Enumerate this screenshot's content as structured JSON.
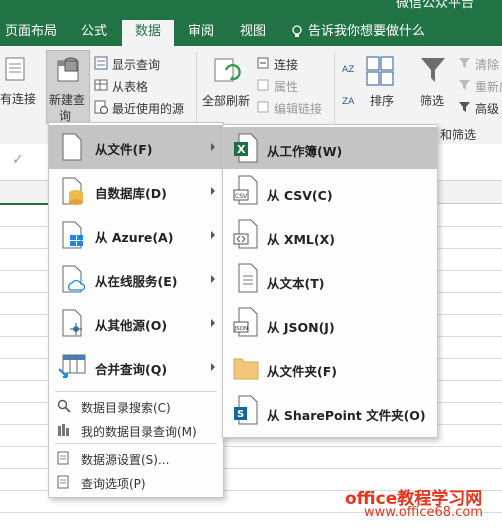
{
  "window": {
    "title_partial": "微信公众平台"
  },
  "tabs": [
    {
      "label": "页面布局"
    },
    {
      "label": "公式"
    },
    {
      "label": "数据"
    },
    {
      "label": "审阅"
    },
    {
      "label": "视图"
    }
  ],
  "tellme": {
    "text": "告诉我你想要做什么"
  },
  "ribbon": {
    "existing_connections": "有连接",
    "new_query_line1": "新建查",
    "new_query_line2": "询",
    "show_queries": "显示查询",
    "from_table": "从表格",
    "recent_sources": "最近使用的源",
    "refresh_all": "全部刷新",
    "connections": "连接",
    "properties": "属性",
    "edit_links": "编辑链接",
    "sort": "排序",
    "filter": "筛选",
    "clear": "清除",
    "reapply": "重新应用",
    "advanced": "高级",
    "filter_group_label": "和筛选"
  },
  "menu1": {
    "items": [
      {
        "label": "从文件(F)"
      },
      {
        "label": "自数据库(D)"
      },
      {
        "label": "从 Azure(A)"
      },
      {
        "label": "从在线服务(E)"
      },
      {
        "label": "从其他源(O)"
      },
      {
        "label": "合并查询(Q)"
      }
    ],
    "extras": [
      {
        "label": "数据目录搜索(C)"
      },
      {
        "label": "我的数据目录查询(M)"
      },
      {
        "label": "数据源设置(S)..."
      },
      {
        "label": "查询选项(P)"
      }
    ]
  },
  "menu2": {
    "items": [
      {
        "label": "从工作簿(W)"
      },
      {
        "label": "从 CSV(C)"
      },
      {
        "label": "从 XML(X)"
      },
      {
        "label": "从文本(T)"
      },
      {
        "label": "从 JSON(J)"
      },
      {
        "label": "从文件夹(F)"
      },
      {
        "label": "从 SharePoint 文件夹(O)"
      }
    ]
  },
  "watermark": {
    "line1": "office教程学习网",
    "line2": "www.office68.com"
  },
  "colors": {
    "accent": "#217346",
    "hover": "#c4c4c4",
    "watermark": "#e6341f"
  }
}
